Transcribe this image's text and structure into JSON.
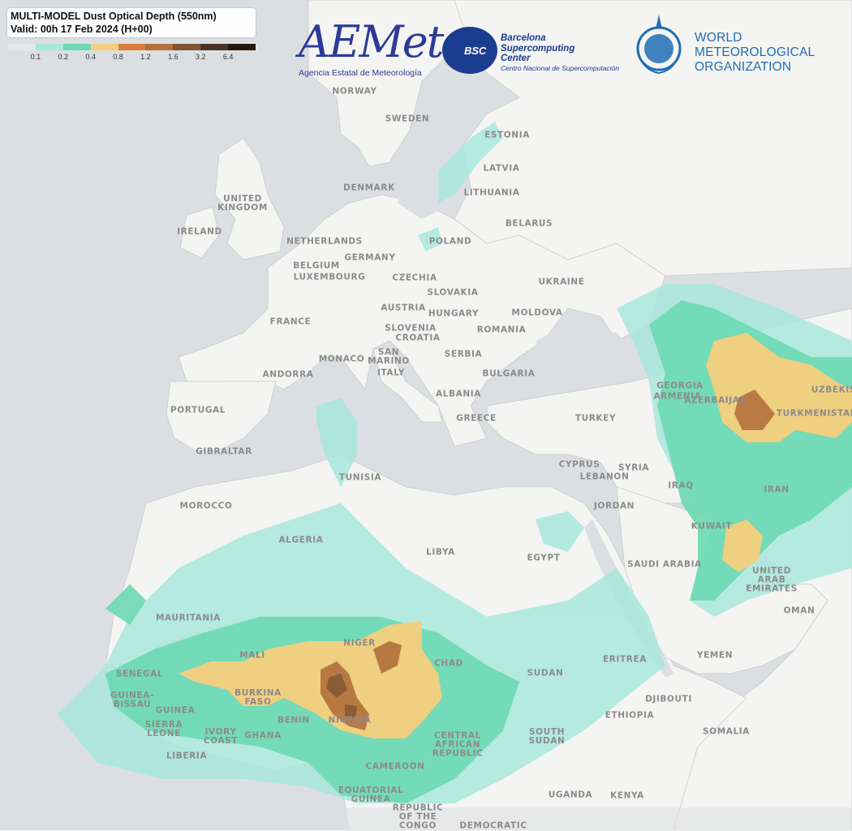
{
  "legend": {
    "title": "MULTI-MODEL Dust Optical Depth (550nm)",
    "valid": "Valid: 00h 17 Feb 2024 (H+00)",
    "colors": [
      "#e4e8e8",
      "#a8e8dc",
      "#6cd9b3",
      "#f6cf7c",
      "#de7b3c",
      "#b2703c",
      "#7e5434",
      "#4d3324",
      "#241710"
    ],
    "ticks": [
      "0.1",
      "0.2",
      "0.4",
      "0.8",
      "1.2",
      "1.6",
      "3.2",
      "6.4"
    ]
  },
  "logos": {
    "aemet_word": "AEMet",
    "aemet_sub": "Agencia Estatal de Meteorología",
    "bsc_short": "BSC",
    "bsc_name": "Barcelona Supercomputing Center",
    "bsc_line1": "Barcelona",
    "bsc_line2": "Supercomputing",
    "bsc_line3": "Center",
    "bsc_sub": "Centro Nacional de Supercomputación",
    "wmo_line1": "WORLD",
    "wmo_line2": "METEOROLOGICAL",
    "wmo_line3": "ORGANIZATION"
  },
  "countries": [
    "NORWAY",
    "SWEDEN",
    "ESTONIA",
    "LATVIA",
    "LITHUANIA",
    "DENMARK",
    "UNITED KINGDOM",
    "IRELAND",
    "BELARUS",
    "NETHERLANDS",
    "POLAND",
    "BELGIUM",
    "GERMANY",
    "LUXEMBOURG",
    "CZECHIA",
    "UKRAINE",
    "SLOVAKIA",
    "AUSTRIA",
    "HUNGARY",
    "MOLDOVA",
    "FRANCE",
    "SLOVENIA",
    "ROMANIA",
    "CROATIA",
    "SAN MARINO",
    "MONACO",
    "SERBIA",
    "ANDORRA",
    "ITALY",
    "BULGARIA",
    "ALBANIA",
    "PORTUGAL",
    "GREECE",
    "TURKEY",
    "GEORGIA",
    "ARMENIA",
    "AZERBAIJAN",
    "TURKMENISTAN",
    "UZBEKISTAN",
    "GIBRALTAR",
    "TUNISIA",
    "CYPRUS",
    "SYRIA",
    "LEBANON",
    "MOROCCO",
    "IRAQ",
    "IRAN",
    "JORDAN",
    "ALGERIA",
    "KUWAIT",
    "LIBYA",
    "EGYPT",
    "SAUDI ARABIA",
    "UNITED ARAB EMIRATES",
    "MAURITANIA",
    "OMAN",
    "NIGER",
    "MALI",
    "ERITREA",
    "YEMEN",
    "CHAD",
    "SENEGAL",
    "SUDAN",
    "BURKINA FASO",
    "DJIBOUTI",
    "GUINEA-BISSAU",
    "GUINEA",
    "BENIN",
    "NIGERIA",
    "ETHIOPIA",
    "SIERRA LEONE",
    "IVORY COAST",
    "GHANA",
    "SOUTH SUDAN",
    "CENTRAL AFRICAN REPUBLIC",
    "SOMALIA",
    "LIBERIA",
    "CAMEROON",
    "EQUATORIAL GUINEA",
    "UGANDA",
    "KENYA",
    "REPUBLIC OF THE CONGO",
    "DEMOCRATIC"
  ]
}
